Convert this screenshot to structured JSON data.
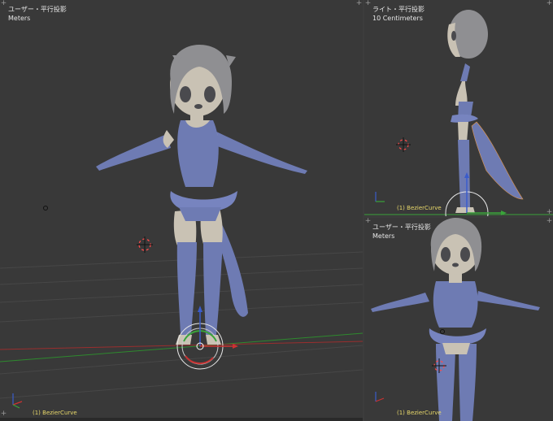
{
  "viewports": {
    "main": {
      "title": "ユーザー・平行投影",
      "unit": "Meters",
      "object": "(1) BezierCurve"
    },
    "right": {
      "title": "ライト・平行投影",
      "unit": "10 Centimeters",
      "object": "(1) BezierCurve"
    },
    "bottom_right": {
      "title": "ユーザー・平行投影",
      "unit": "Meters",
      "object": "(1) BezierCurve"
    }
  },
  "corner_glyph": "+",
  "colors": {
    "viewport_bg": "#393939",
    "grid": "#4a4a4a",
    "axis_x": "#b03030",
    "axis_y": "#3a9a3a",
    "character_body": "#6e7bb3",
    "character_skin": "#c9c2b4",
    "character_hair": "#8f8f92",
    "object_label": "#e8d86a"
  },
  "icons": [
    "cursor-3d-icon",
    "transform-manipulator-icon",
    "axis-gizmo-icon",
    "lamp-icon"
  ]
}
